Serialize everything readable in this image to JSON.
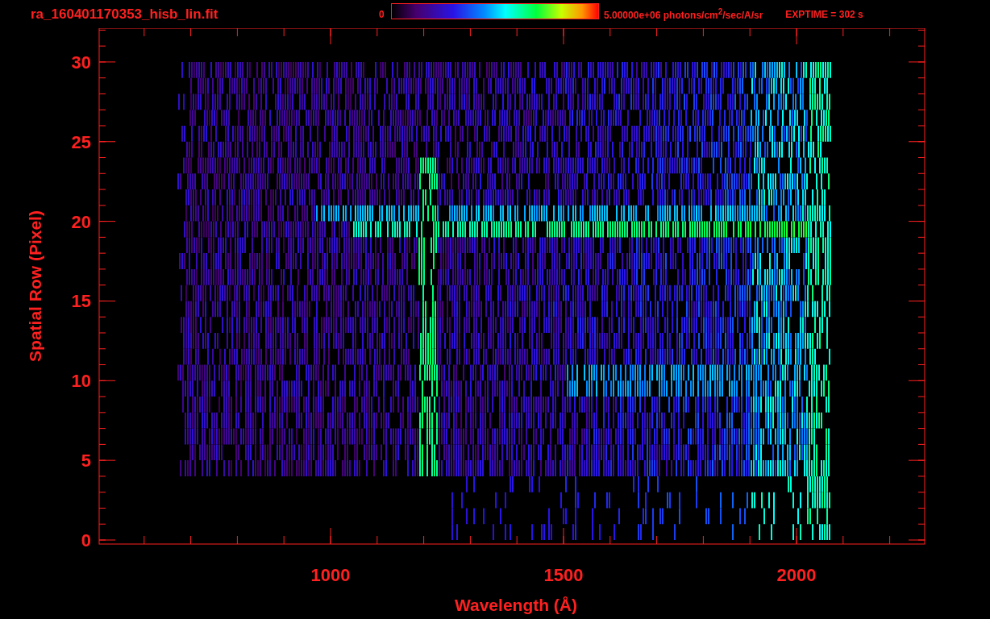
{
  "title": "ra_160401170353_hisb_lin.fit",
  "colorbar": {
    "min_label": "0",
    "max_label": "5.00000e+06 photons/cm$^{2}$/sec/A/sr"
  },
  "exposure": "EXPTIME = 302 s",
  "plot": {
    "xlabel": "Wavelength (Å)",
    "ylabel": "Spatial Row (Pixel)",
    "xticks": [
      "1000",
      "1500",
      "2000"
    ],
    "yticks": [
      "30",
      "25",
      "20",
      "15",
      "10",
      "5",
      "0"
    ]
  }
}
